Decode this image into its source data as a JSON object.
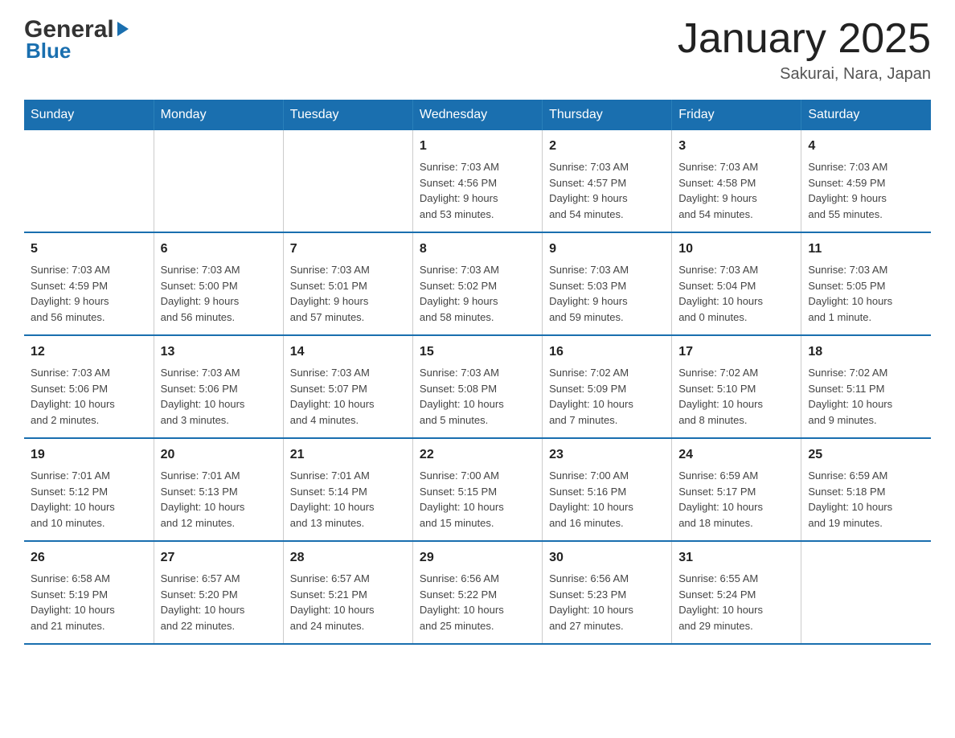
{
  "header": {
    "logo_general": "General",
    "logo_blue": "Blue",
    "month_title": "January 2025",
    "location": "Sakurai, Nara, Japan"
  },
  "days_of_week": [
    "Sunday",
    "Monday",
    "Tuesday",
    "Wednesday",
    "Thursday",
    "Friday",
    "Saturday"
  ],
  "weeks": [
    [
      {
        "day": "",
        "info": ""
      },
      {
        "day": "",
        "info": ""
      },
      {
        "day": "",
        "info": ""
      },
      {
        "day": "1",
        "info": "Sunrise: 7:03 AM\nSunset: 4:56 PM\nDaylight: 9 hours\nand 53 minutes."
      },
      {
        "day": "2",
        "info": "Sunrise: 7:03 AM\nSunset: 4:57 PM\nDaylight: 9 hours\nand 54 minutes."
      },
      {
        "day": "3",
        "info": "Sunrise: 7:03 AM\nSunset: 4:58 PM\nDaylight: 9 hours\nand 54 minutes."
      },
      {
        "day": "4",
        "info": "Sunrise: 7:03 AM\nSunset: 4:59 PM\nDaylight: 9 hours\nand 55 minutes."
      }
    ],
    [
      {
        "day": "5",
        "info": "Sunrise: 7:03 AM\nSunset: 4:59 PM\nDaylight: 9 hours\nand 56 minutes."
      },
      {
        "day": "6",
        "info": "Sunrise: 7:03 AM\nSunset: 5:00 PM\nDaylight: 9 hours\nand 56 minutes."
      },
      {
        "day": "7",
        "info": "Sunrise: 7:03 AM\nSunset: 5:01 PM\nDaylight: 9 hours\nand 57 minutes."
      },
      {
        "day": "8",
        "info": "Sunrise: 7:03 AM\nSunset: 5:02 PM\nDaylight: 9 hours\nand 58 minutes."
      },
      {
        "day": "9",
        "info": "Sunrise: 7:03 AM\nSunset: 5:03 PM\nDaylight: 9 hours\nand 59 minutes."
      },
      {
        "day": "10",
        "info": "Sunrise: 7:03 AM\nSunset: 5:04 PM\nDaylight: 10 hours\nand 0 minutes."
      },
      {
        "day": "11",
        "info": "Sunrise: 7:03 AM\nSunset: 5:05 PM\nDaylight: 10 hours\nand 1 minute."
      }
    ],
    [
      {
        "day": "12",
        "info": "Sunrise: 7:03 AM\nSunset: 5:06 PM\nDaylight: 10 hours\nand 2 minutes."
      },
      {
        "day": "13",
        "info": "Sunrise: 7:03 AM\nSunset: 5:06 PM\nDaylight: 10 hours\nand 3 minutes."
      },
      {
        "day": "14",
        "info": "Sunrise: 7:03 AM\nSunset: 5:07 PM\nDaylight: 10 hours\nand 4 minutes."
      },
      {
        "day": "15",
        "info": "Sunrise: 7:03 AM\nSunset: 5:08 PM\nDaylight: 10 hours\nand 5 minutes."
      },
      {
        "day": "16",
        "info": "Sunrise: 7:02 AM\nSunset: 5:09 PM\nDaylight: 10 hours\nand 7 minutes."
      },
      {
        "day": "17",
        "info": "Sunrise: 7:02 AM\nSunset: 5:10 PM\nDaylight: 10 hours\nand 8 minutes."
      },
      {
        "day": "18",
        "info": "Sunrise: 7:02 AM\nSunset: 5:11 PM\nDaylight: 10 hours\nand 9 minutes."
      }
    ],
    [
      {
        "day": "19",
        "info": "Sunrise: 7:01 AM\nSunset: 5:12 PM\nDaylight: 10 hours\nand 10 minutes."
      },
      {
        "day": "20",
        "info": "Sunrise: 7:01 AM\nSunset: 5:13 PM\nDaylight: 10 hours\nand 12 minutes."
      },
      {
        "day": "21",
        "info": "Sunrise: 7:01 AM\nSunset: 5:14 PM\nDaylight: 10 hours\nand 13 minutes."
      },
      {
        "day": "22",
        "info": "Sunrise: 7:00 AM\nSunset: 5:15 PM\nDaylight: 10 hours\nand 15 minutes."
      },
      {
        "day": "23",
        "info": "Sunrise: 7:00 AM\nSunset: 5:16 PM\nDaylight: 10 hours\nand 16 minutes."
      },
      {
        "day": "24",
        "info": "Sunrise: 6:59 AM\nSunset: 5:17 PM\nDaylight: 10 hours\nand 18 minutes."
      },
      {
        "day": "25",
        "info": "Sunrise: 6:59 AM\nSunset: 5:18 PM\nDaylight: 10 hours\nand 19 minutes."
      }
    ],
    [
      {
        "day": "26",
        "info": "Sunrise: 6:58 AM\nSunset: 5:19 PM\nDaylight: 10 hours\nand 21 minutes."
      },
      {
        "day": "27",
        "info": "Sunrise: 6:57 AM\nSunset: 5:20 PM\nDaylight: 10 hours\nand 22 minutes."
      },
      {
        "day": "28",
        "info": "Sunrise: 6:57 AM\nSunset: 5:21 PM\nDaylight: 10 hours\nand 24 minutes."
      },
      {
        "day": "29",
        "info": "Sunrise: 6:56 AM\nSunset: 5:22 PM\nDaylight: 10 hours\nand 25 minutes."
      },
      {
        "day": "30",
        "info": "Sunrise: 6:56 AM\nSunset: 5:23 PM\nDaylight: 10 hours\nand 27 minutes."
      },
      {
        "day": "31",
        "info": "Sunrise: 6:55 AM\nSunset: 5:24 PM\nDaylight: 10 hours\nand 29 minutes."
      },
      {
        "day": "",
        "info": ""
      }
    ]
  ]
}
